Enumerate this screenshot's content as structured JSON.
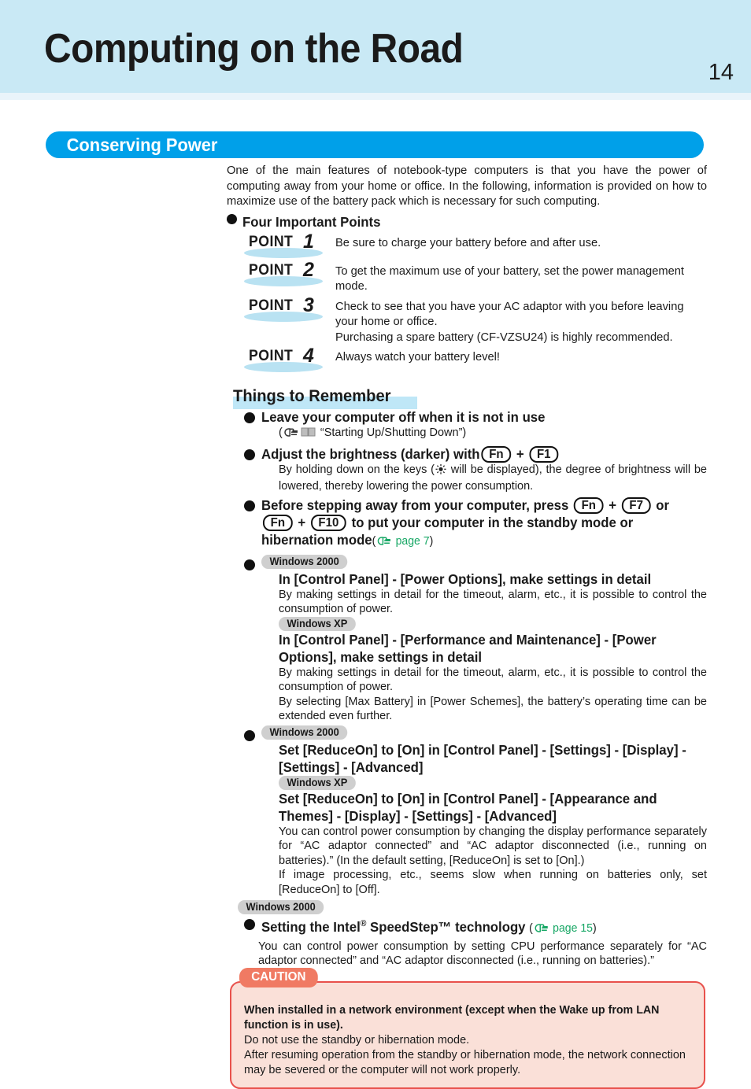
{
  "header": {
    "title": "Computing on the Road",
    "page_number": "14",
    "band_color": "#c9e9f5"
  },
  "section": {
    "banner_label": "Conserving Power",
    "banner_color": "#00a0e9",
    "intro": "One of the main features of notebook-type computers is that you have the power of computing away from your home or office.  In the following, information is provided on how to maximize use of the battery pack which is necessary for such computing.",
    "four_points_heading": "Four Important Points"
  },
  "points": [
    {
      "label": "POINT",
      "number": "1",
      "text": "Be sure to charge your battery before and after use."
    },
    {
      "label": "POINT",
      "number": "2",
      "text": "To get the maximum use of your battery, set the power management mode."
    },
    {
      "label": "POINT",
      "number": "3",
      "text": "Check to see that you have your AC adaptor with you before leaving your home or office.",
      "text2": "Purchasing a spare battery (CF-VZSU24) is highly recommended."
    },
    {
      "label": "POINT",
      "number": "4",
      "text": "Always watch your battery level!"
    }
  ],
  "things_to_remember": {
    "heading": "Things to Remember",
    "highlight_color": "#bfe7f7",
    "items": {
      "leave_off": {
        "title": "Leave your computer off when it is not in use",
        "ref_open": "(",
        "ref_text": "“Starting Up/Shutting Down”)",
        "hand_icon": "pointing-hand-icon",
        "book_icon": "book-icon"
      },
      "brightness": {
        "title_a": "Adjust the brightness (darker) with",
        "key1": "Fn",
        "plus": "+",
        "key2": "F1",
        "body_a": "By holding down on the keys (",
        "sun_icon": "brightness-sun-icon",
        "body_b": " will be displayed), the degree of brightness will be lowered, thereby lowering the power consumption."
      },
      "standby": {
        "title_a": "Before stepping away from your computer, press",
        "key1": "Fn",
        "plus1": "+",
        "key2": "F7",
        "title_b": "or",
        "key3": "Fn",
        "plus2": "+",
        "key4": "F10",
        "title_c": "to put your computer in the standby mode or hibernation mode",
        "ref_open": "(",
        "ref_text": "page 7",
        "ref_close": ")",
        "ref_color": "#17a765"
      },
      "power_options": {
        "badge_2000": "Windows 2000",
        "title_2000": "In [Control Panel] - [Power Options], make settings in detail",
        "body_2000": "By making settings in detail for the timeout, alarm, etc., it is possible to control the consumption of power.",
        "badge_xp": "Windows XP",
        "title_xp": "In [Control Panel] - [Performance and Maintenance] - [Power Options], make settings in detail",
        "body_xp_1": "By making settings in detail for the timeout, alarm, etc., it is possible to control the consumption of power.",
        "body_xp_2": "By selecting [Max Battery] in [Power Schemes], the battery’s operating time can be extended even further."
      },
      "reduce_on": {
        "badge_2000": "Windows 2000",
        "title_2000": "Set [ReduceOn] to [On] in [Control Panel] - [Settings] - [Display] - [Settings] - [Advanced]",
        "badge_xp": "Windows XP",
        "title_xp": "Set [ReduceOn] to [On] in [Control Panel] - [Appearance and Themes] - [Display] - [Settings] - [Advanced]",
        "body_1": "You can control power consumption by changing the display performance separately for “AC adaptor connected” and “AC adaptor disconnected (i.e., running on batteries).”  (In the default setting, [ReduceOn] is set to [On].)",
        "body_2": "If image processing, etc., seems slow when running on batteries only, set [ReduceOn] to [Off]."
      },
      "speedstep": {
        "badge_2000": "Windows 2000",
        "title_a": "Setting the Intel",
        "title_reg": "®",
        "title_b": " SpeedStep™ technology",
        "ref_open": "(",
        "ref_text": "page 15",
        "ref_close": ")",
        "body": "You can control power consumption by setting CPU performance separately for “AC adaptor connected” and “AC adaptor disconnected (i.e., running on batteries).”"
      }
    }
  },
  "caution": {
    "tab_label": "CAUTION",
    "border_color": "#e8514c",
    "background_color": "#fae0d8",
    "tab_color": "#f07a63",
    "strong_text": "When installed in a network environment (except when the Wake up from LAN function is in use).",
    "line_1": "Do not use the standby or hibernation mode.",
    "line_2": "After resuming operation from the standby or hibernation mode, the network connection may be severed or the computer will not work properly."
  }
}
